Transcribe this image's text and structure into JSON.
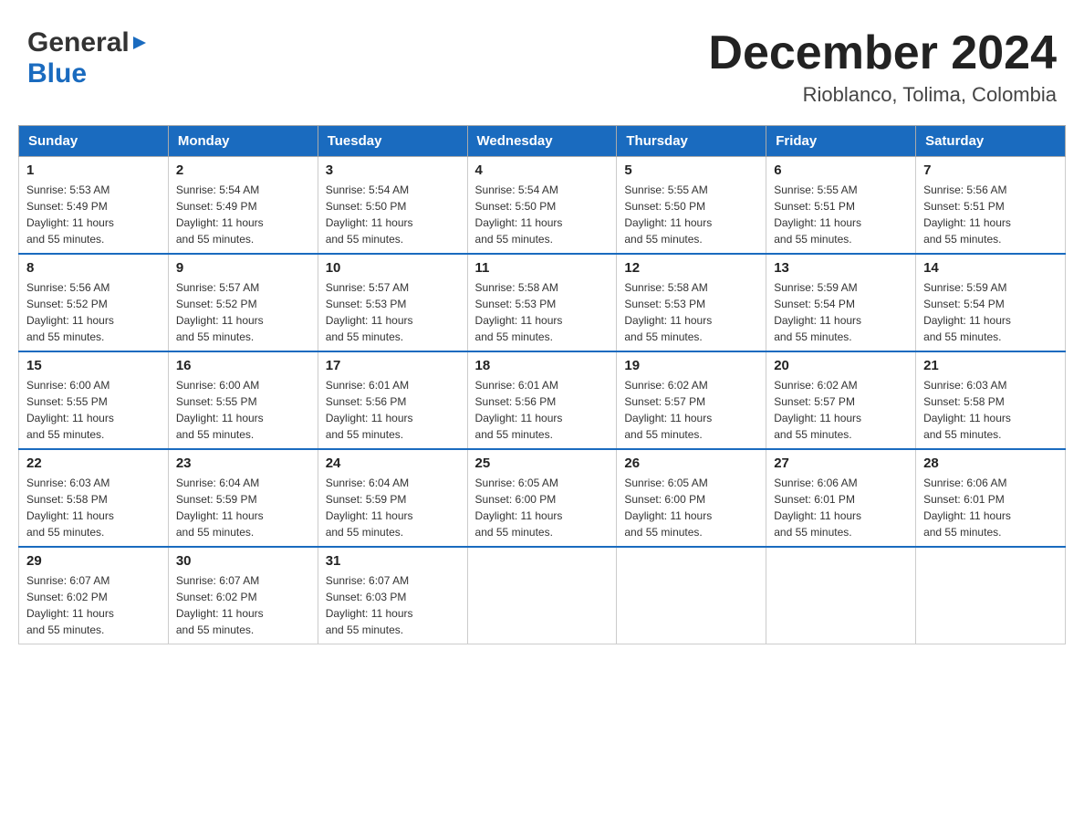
{
  "header": {
    "logo": {
      "general": "General",
      "blue": "Blue",
      "arrow": "▶"
    },
    "title": "December 2024",
    "location": "Rioblanco, Tolima, Colombia"
  },
  "days_of_week": [
    "Sunday",
    "Monday",
    "Tuesday",
    "Wednesday",
    "Thursday",
    "Friday",
    "Saturday"
  ],
  "weeks": [
    [
      {
        "day": "1",
        "sunrise": "5:53 AM",
        "sunset": "5:49 PM",
        "daylight": "11 hours and 55 minutes."
      },
      {
        "day": "2",
        "sunrise": "5:54 AM",
        "sunset": "5:49 PM",
        "daylight": "11 hours and 55 minutes."
      },
      {
        "day": "3",
        "sunrise": "5:54 AM",
        "sunset": "5:50 PM",
        "daylight": "11 hours and 55 minutes."
      },
      {
        "day": "4",
        "sunrise": "5:54 AM",
        "sunset": "5:50 PM",
        "daylight": "11 hours and 55 minutes."
      },
      {
        "day": "5",
        "sunrise": "5:55 AM",
        "sunset": "5:50 PM",
        "daylight": "11 hours and 55 minutes."
      },
      {
        "day": "6",
        "sunrise": "5:55 AM",
        "sunset": "5:51 PM",
        "daylight": "11 hours and 55 minutes."
      },
      {
        "day": "7",
        "sunrise": "5:56 AM",
        "sunset": "5:51 PM",
        "daylight": "11 hours and 55 minutes."
      }
    ],
    [
      {
        "day": "8",
        "sunrise": "5:56 AM",
        "sunset": "5:52 PM",
        "daylight": "11 hours and 55 minutes."
      },
      {
        "day": "9",
        "sunrise": "5:57 AM",
        "sunset": "5:52 PM",
        "daylight": "11 hours and 55 minutes."
      },
      {
        "day": "10",
        "sunrise": "5:57 AM",
        "sunset": "5:53 PM",
        "daylight": "11 hours and 55 minutes."
      },
      {
        "day": "11",
        "sunrise": "5:58 AM",
        "sunset": "5:53 PM",
        "daylight": "11 hours and 55 minutes."
      },
      {
        "day": "12",
        "sunrise": "5:58 AM",
        "sunset": "5:53 PM",
        "daylight": "11 hours and 55 minutes."
      },
      {
        "day": "13",
        "sunrise": "5:59 AM",
        "sunset": "5:54 PM",
        "daylight": "11 hours and 55 minutes."
      },
      {
        "day": "14",
        "sunrise": "5:59 AM",
        "sunset": "5:54 PM",
        "daylight": "11 hours and 55 minutes."
      }
    ],
    [
      {
        "day": "15",
        "sunrise": "6:00 AM",
        "sunset": "5:55 PM",
        "daylight": "11 hours and 55 minutes."
      },
      {
        "day": "16",
        "sunrise": "6:00 AM",
        "sunset": "5:55 PM",
        "daylight": "11 hours and 55 minutes."
      },
      {
        "day": "17",
        "sunrise": "6:01 AM",
        "sunset": "5:56 PM",
        "daylight": "11 hours and 55 minutes."
      },
      {
        "day": "18",
        "sunrise": "6:01 AM",
        "sunset": "5:56 PM",
        "daylight": "11 hours and 55 minutes."
      },
      {
        "day": "19",
        "sunrise": "6:02 AM",
        "sunset": "5:57 PM",
        "daylight": "11 hours and 55 minutes."
      },
      {
        "day": "20",
        "sunrise": "6:02 AM",
        "sunset": "5:57 PM",
        "daylight": "11 hours and 55 minutes."
      },
      {
        "day": "21",
        "sunrise": "6:03 AM",
        "sunset": "5:58 PM",
        "daylight": "11 hours and 55 minutes."
      }
    ],
    [
      {
        "day": "22",
        "sunrise": "6:03 AM",
        "sunset": "5:58 PM",
        "daylight": "11 hours and 55 minutes."
      },
      {
        "day": "23",
        "sunrise": "6:04 AM",
        "sunset": "5:59 PM",
        "daylight": "11 hours and 55 minutes."
      },
      {
        "day": "24",
        "sunrise": "6:04 AM",
        "sunset": "5:59 PM",
        "daylight": "11 hours and 55 minutes."
      },
      {
        "day": "25",
        "sunrise": "6:05 AM",
        "sunset": "6:00 PM",
        "daylight": "11 hours and 55 minutes."
      },
      {
        "day": "26",
        "sunrise": "6:05 AM",
        "sunset": "6:00 PM",
        "daylight": "11 hours and 55 minutes."
      },
      {
        "day": "27",
        "sunrise": "6:06 AM",
        "sunset": "6:01 PM",
        "daylight": "11 hours and 55 minutes."
      },
      {
        "day": "28",
        "sunrise": "6:06 AM",
        "sunset": "6:01 PM",
        "daylight": "11 hours and 55 minutes."
      }
    ],
    [
      {
        "day": "29",
        "sunrise": "6:07 AM",
        "sunset": "6:02 PM",
        "daylight": "11 hours and 55 minutes."
      },
      {
        "day": "30",
        "sunrise": "6:07 AM",
        "sunset": "6:02 PM",
        "daylight": "11 hours and 55 minutes."
      },
      {
        "day": "31",
        "sunrise": "6:07 AM",
        "sunset": "6:03 PM",
        "daylight": "11 hours and 55 minutes."
      },
      null,
      null,
      null,
      null
    ]
  ],
  "labels": {
    "sunrise": "Sunrise:",
    "sunset": "Sunset:",
    "daylight": "Daylight: 11 hours"
  }
}
